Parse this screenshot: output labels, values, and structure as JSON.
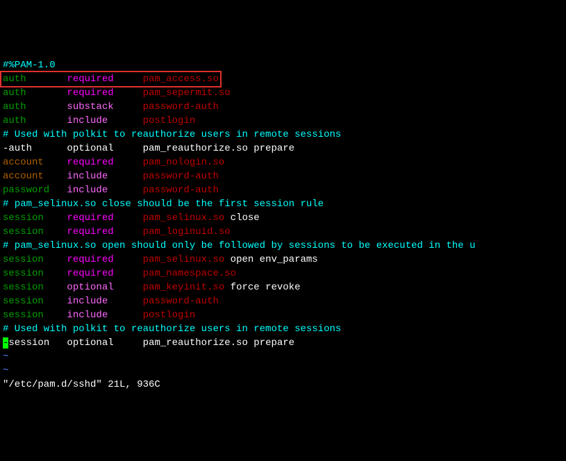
{
  "header": "#%PAM-1.0",
  "lines": [
    {
      "col1": "auth",
      "col2": "required",
      "col3": "pam_access.so",
      "boxed": true,
      "c1": "green",
      "c2": "magenta",
      "c3": "red"
    },
    {
      "col1": "auth",
      "col2": "required",
      "col3": "pam_sepermit.so",
      "c1": "green",
      "c2": "magenta",
      "c3": "red"
    },
    {
      "col1": "auth",
      "col2": "substack",
      "col3": "password-auth",
      "c1": "green",
      "c2": "brightmagenta",
      "c3": "red"
    },
    {
      "col1": "auth",
      "col2": "include",
      "col3": "postlogin",
      "c1": "green",
      "c2": "brightmagenta",
      "c3": "red"
    }
  ],
  "comment1": "# Used with polkit to reauthorize users in remote sessions",
  "line5": {
    "col1": "-auth",
    "col2": "optional",
    "col3": "pam_reauthorize.so prepare"
  },
  "lines2": [
    {
      "col1": "account",
      "col2": "required",
      "col3": "pam_nologin.so",
      "c1": "darkorange",
      "c2": "magenta",
      "c3": "red"
    },
    {
      "col1": "account",
      "col2": "include",
      "col3": "password-auth",
      "c1": "darkorange",
      "c2": "brightmagenta",
      "c3": "red"
    },
    {
      "col1": "password",
      "col2": "include",
      "col3": "password-auth",
      "c1": "green",
      "c2": "brightmagenta",
      "c3": "red"
    }
  ],
  "comment2": "# pam_selinux.so close should be the first session rule",
  "lines3": [
    {
      "col1": "session",
      "col2": "required",
      "col3": "pam_selinux.so",
      "rest": " close",
      "c1": "green",
      "c2": "magenta",
      "c3": "red"
    },
    {
      "col1": "session",
      "col2": "required",
      "col3": "pam_loginuid.so",
      "c1": "green",
      "c2": "magenta",
      "c3": "red"
    }
  ],
  "comment3": "# pam_selinux.so open should only be followed by sessions to be executed in the u",
  "lines4": [
    {
      "col1": "session",
      "col2": "required",
      "col3": "pam_selinux.so",
      "rest": " open env_params",
      "c1": "green",
      "c2": "magenta",
      "c3": "red"
    },
    {
      "col1": "session",
      "col2": "required",
      "col3": "pam_namespace.so",
      "c1": "green",
      "c2": "magenta",
      "c3": "red"
    },
    {
      "col1": "session",
      "col2": "optional",
      "col3": "pam_keyinit.so",
      "rest": " force revoke",
      "c1": "green",
      "c2": "brightmagenta",
      "c3": "red"
    },
    {
      "col1": "session",
      "col2": "include",
      "col3": "password-auth",
      "c1": "green",
      "c2": "brightmagenta",
      "c3": "red"
    },
    {
      "col1": "session",
      "col2": "include",
      "col3": "postlogin",
      "c1": "green",
      "c2": "brightmagenta",
      "c3": "red"
    }
  ],
  "comment4": "# Used with polkit to reauthorize users in remote sessions",
  "lastline": {
    "cursor": "-",
    "col1": "session",
    "col2": "optional",
    "col3": "pam_reauthorize.so prepare"
  },
  "tilde": "~",
  "status": "\"/etc/pam.d/sshd\" 21L, 936C"
}
